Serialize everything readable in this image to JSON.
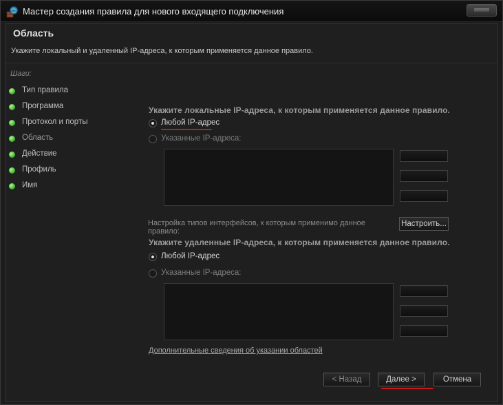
{
  "window": {
    "title": "Мастер создания правила для нового входящего подключения"
  },
  "header": {
    "title": "Область",
    "description": "Укажите локальный и удаленный IP-адреса, к которым применяется данное правило."
  },
  "steps": {
    "title": "Шаги:",
    "items": [
      {
        "label": "Тип правила"
      },
      {
        "label": "Программа"
      },
      {
        "label": "Протокол и порты"
      },
      {
        "label": "Область"
      },
      {
        "label": "Действие"
      },
      {
        "label": "Профиль"
      },
      {
        "label": "Имя"
      }
    ]
  },
  "local": {
    "heading": "Укажите локальные IP-адреса, к которым применяется данное правило.",
    "any_label": "Любой IP-адрес",
    "specified_label": "Указанные IP-адреса:",
    "selected": "any"
  },
  "interfaces": {
    "text": "Настройка типов интерфейсов, к которым применимо данное правило:",
    "button_label": "Настроить..."
  },
  "remote": {
    "heading": "Укажите удаленные IP-адреса, к которым применяется данное правило.",
    "any_label": "Любой IP-адрес",
    "specified_label": "Указанные IP-адреса:",
    "selected": "any"
  },
  "footer": {
    "info_link": "Дополнительные сведения об указании областей",
    "back_label": "< Назад",
    "next_label": "Далее >",
    "cancel_label": "Отмена"
  },
  "colors": {
    "step_dot": "#4cc236",
    "annotation_underline": "#d01818"
  }
}
